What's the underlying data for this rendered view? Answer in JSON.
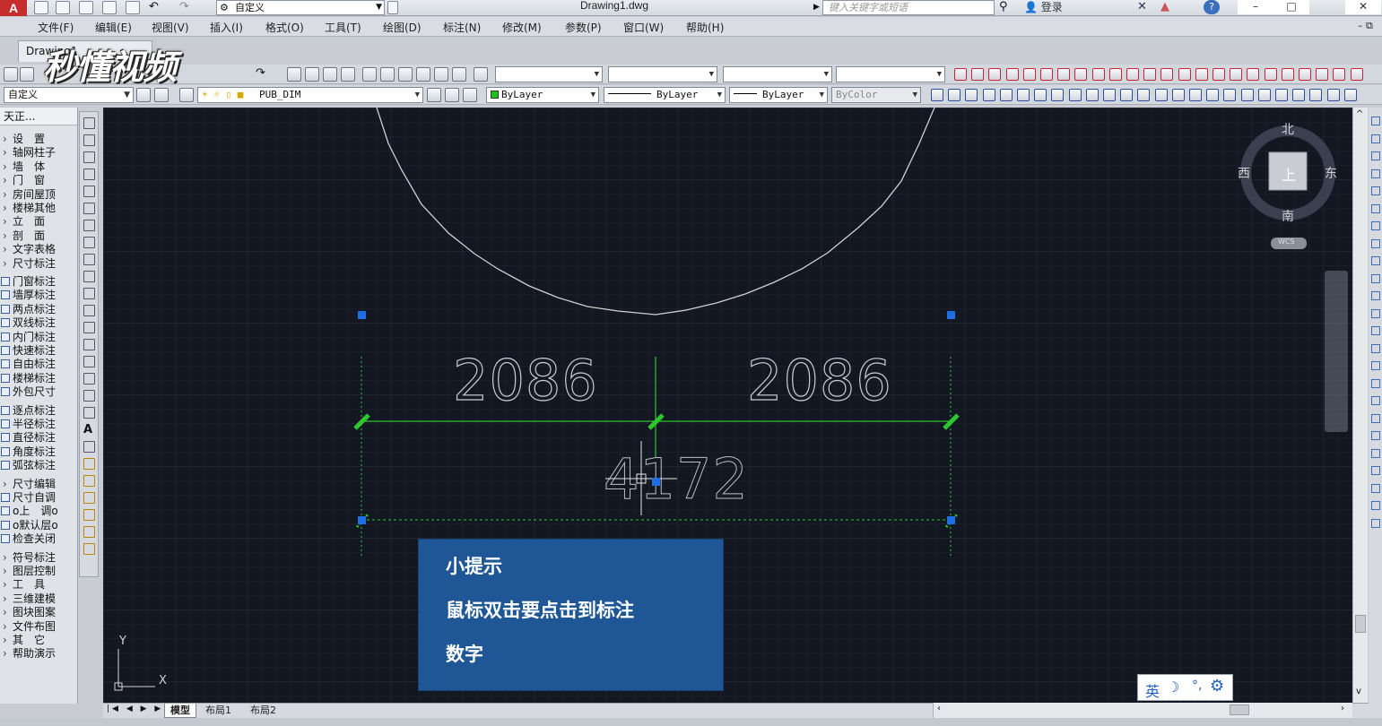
{
  "app": {
    "logo": "A",
    "workspace": "自定义",
    "document_title": "Drawing1.dwg",
    "search_placeholder": "键入关键字或短语",
    "login_label": "登录",
    "doc_tab": "Drawing1"
  },
  "menu": {
    "items": [
      "文件(F)",
      "编辑(E)",
      "视图(V)",
      "插入(I)",
      "格式(O)",
      "工具(T)",
      "绘图(D)",
      "标注(N)",
      "修改(M)",
      "参数(P)",
      "窗口(W)",
      "帮助(H)"
    ]
  },
  "toolbar": {
    "workspace_combo": "自定义",
    "layer_combo": "PUB_DIM",
    "color_combo": "ByLayer",
    "linetype_combo": "ByLayer",
    "lineweight_combo": "ByLayer",
    "plotstyle_combo": "ByColor"
  },
  "tianzheng": {
    "header": "天正...",
    "items": [
      {
        "label": "设　置",
        "kind": "arrow"
      },
      {
        "label": "轴网柱子",
        "kind": "arrow"
      },
      {
        "label": "墙　体",
        "kind": "arrow"
      },
      {
        "label": "门　窗",
        "kind": "arrow"
      },
      {
        "label": "房间屋顶",
        "kind": "arrow"
      },
      {
        "label": "楼梯其他",
        "kind": "arrow"
      },
      {
        "label": "立　面",
        "kind": "arrow"
      },
      {
        "label": "剖　面",
        "kind": "arrow"
      },
      {
        "label": "文字表格",
        "kind": "arrow"
      },
      {
        "label": "尺寸标注",
        "kind": "arrow"
      },
      {
        "label": "门窗标注",
        "kind": "icon"
      },
      {
        "label": "墙厚标注",
        "kind": "icon"
      },
      {
        "label": "两点标注",
        "kind": "icon"
      },
      {
        "label": "双线标注",
        "kind": "icon"
      },
      {
        "label": "内门标注",
        "kind": "icon"
      },
      {
        "label": "快速标注",
        "kind": "icon"
      },
      {
        "label": "自由标注",
        "kind": "icon"
      },
      {
        "label": "楼梯标注",
        "kind": "icon"
      },
      {
        "label": "外包尺寸",
        "kind": "icon"
      },
      {
        "label": "逐点标注",
        "kind": "icon"
      },
      {
        "label": "半径标注",
        "kind": "icon"
      },
      {
        "label": "直径标注",
        "kind": "icon"
      },
      {
        "label": "角度标注",
        "kind": "icon"
      },
      {
        "label": "弧弦标注",
        "kind": "icon"
      },
      {
        "label": "尺寸编辑",
        "kind": "arrow"
      },
      {
        "label": "尺寸自调",
        "kind": "icon"
      },
      {
        "label": "o上　调o",
        "kind": "icon"
      },
      {
        "label": "o默认层o",
        "kind": "icon"
      },
      {
        "label": "检查关闭",
        "kind": "icon"
      },
      {
        "label": "符号标注",
        "kind": "arrow"
      },
      {
        "label": "图层控制",
        "kind": "arrow"
      },
      {
        "label": "工　具",
        "kind": "arrow"
      },
      {
        "label": "三维建模",
        "kind": "arrow"
      },
      {
        "label": "图块图案",
        "kind": "arrow"
      },
      {
        "label": "文件布图",
        "kind": "arrow"
      },
      {
        "label": "其　它",
        "kind": "arrow"
      },
      {
        "label": "帮助演示",
        "kind": "arrow"
      }
    ]
  },
  "drawing": {
    "dim_left": "2086",
    "dim_right": "2086",
    "dim_total": "4172",
    "ucs_y": "Y",
    "ucs_x": "X",
    "compass": {
      "north": "北",
      "south": "南",
      "east": "东",
      "west": "西",
      "top": "上",
      "wcs": "WCS"
    }
  },
  "tip": {
    "title": "小提示",
    "line1": "鼠标双击要点击到标注",
    "line2": "数字"
  },
  "ime": {
    "lang": "英"
  },
  "tabs": {
    "model": "模型",
    "layout1": "布局1",
    "layout2": "布局2"
  },
  "watermark": "秒懂视频",
  "colors": {
    "canvas_bg": "#131722",
    "dim_green": "#2fc52f",
    "grip_blue": "#1e6fe6",
    "tip_bg": "#1f5796",
    "app_red": "#c62d2d"
  }
}
